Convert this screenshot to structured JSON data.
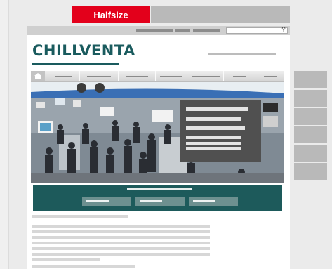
{
  "banner": {
    "halfsize_label": "Halfsize"
  },
  "header": {
    "logo_text": "CHILLVENTA"
  },
  "search": {
    "icon": "search-icon"
  },
  "nav": {
    "home_icon": "home-icon",
    "item_count": 7
  },
  "colors": {
    "accent_red": "#e3001b",
    "brand_teal": "#1d5a5b",
    "overlay": "#505050"
  }
}
